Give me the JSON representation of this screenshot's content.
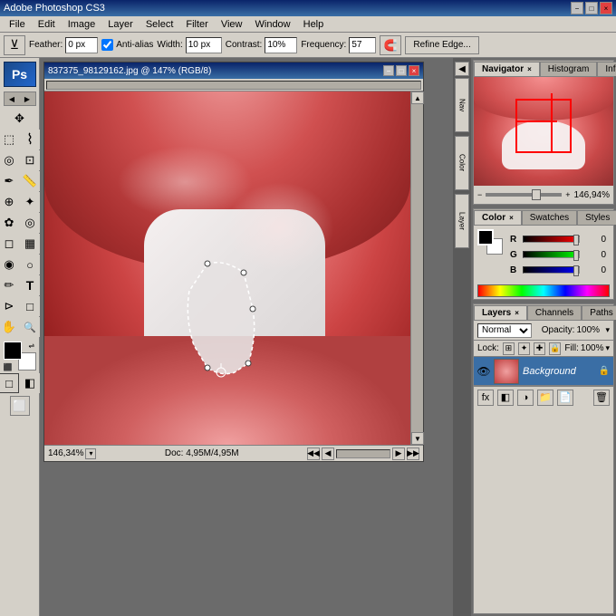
{
  "app": {
    "title": "Adobe Photoshop CS3",
    "win_controls": [
      "−",
      "□",
      "×"
    ]
  },
  "menu": {
    "items": [
      "File",
      "Edit",
      "Image",
      "Layer",
      "Select",
      "Filter",
      "View",
      "Window",
      "Help"
    ]
  },
  "toolbar": {
    "feather_label": "Feather:",
    "feather_value": "0 px",
    "anti_alias_label": "Anti-alias",
    "width_label": "Width:",
    "width_value": "10 px",
    "contrast_label": "Contrast:",
    "contrast_value": "10%",
    "frequency_label": "Frequency:",
    "frequency_value": "57",
    "refine_edge_label": "Refine Edge..."
  },
  "doc_window": {
    "title": "837375_98129162.jpg @ 147% (RGB/8)",
    "status_zoom": "146,34%",
    "status_doc": "Doc: 4,95M/4,95M",
    "controls": [
      "−",
      "□",
      "×"
    ]
  },
  "navigator": {
    "tabs": [
      "Navigator",
      "Histogram",
      "Info"
    ],
    "zoom_value": "146,94%"
  },
  "color": {
    "tabs": [
      "Color",
      "Swatches",
      "Styles"
    ],
    "r_label": "R",
    "g_label": "G",
    "b_label": "B",
    "r_value": "0",
    "g_value": "0",
    "b_value": "0"
  },
  "layers": {
    "tabs": [
      "Layers",
      "Channels",
      "Paths"
    ],
    "blend_mode": "Normal",
    "opacity_label": "Opacity:",
    "opacity_value": "100%",
    "fill_label": "Fill:",
    "fill_value": "100%",
    "lock_label": "Lock:",
    "layer_name": "Background"
  },
  "toolbox": {
    "tools": [
      {
        "name": "move",
        "icon": "✥"
      },
      {
        "name": "rectangle-select",
        "icon": "⬚"
      },
      {
        "name": "lasso",
        "icon": "⌇"
      },
      {
        "name": "quick-select",
        "icon": "⬤"
      },
      {
        "name": "crop",
        "icon": "⊡"
      },
      {
        "name": "eyedropper",
        "icon": "✒"
      },
      {
        "name": "spot-heal",
        "icon": "⊕"
      },
      {
        "name": "brush",
        "icon": "✦"
      },
      {
        "name": "clone-stamp",
        "icon": "✿"
      },
      {
        "name": "history-brush",
        "icon": "◎"
      },
      {
        "name": "eraser",
        "icon": "◻"
      },
      {
        "name": "gradient",
        "icon": "▦"
      },
      {
        "name": "blur",
        "icon": "◉"
      },
      {
        "name": "dodge",
        "icon": "○"
      },
      {
        "name": "pen",
        "icon": "✏"
      },
      {
        "name": "type",
        "icon": "T"
      },
      {
        "name": "path-select",
        "icon": "⊳"
      },
      {
        "name": "rectangle-shape",
        "icon": "□"
      },
      {
        "name": "hand",
        "icon": "✋"
      },
      {
        "name": "zoom",
        "icon": "🔍"
      },
      {
        "name": "foreground-color",
        "icon": "■"
      },
      {
        "name": "background-color",
        "icon": "□"
      }
    ]
  }
}
